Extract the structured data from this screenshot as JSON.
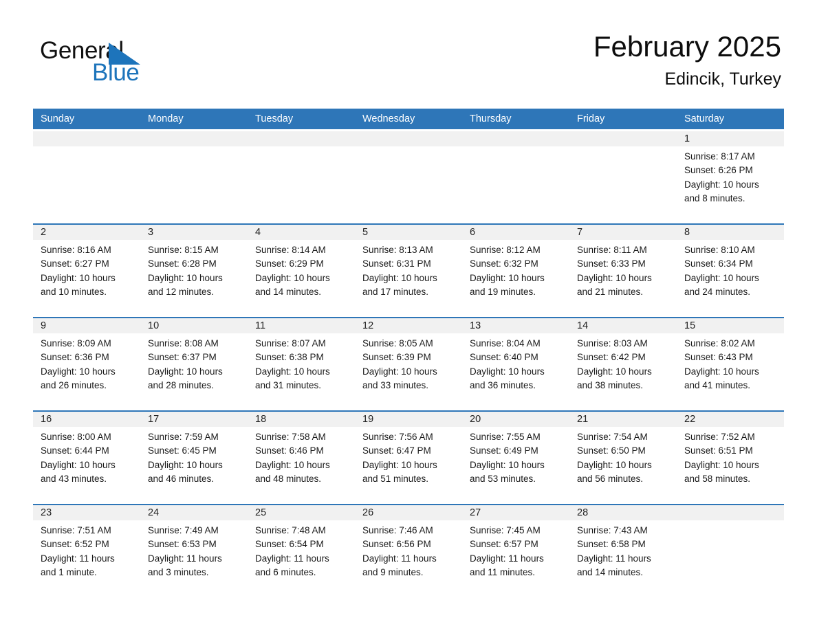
{
  "brand": {
    "name_part1": "General",
    "name_part2": "Blue",
    "accent_color": "#1d74bb",
    "triangle_icon": "triangle-icon"
  },
  "header": {
    "title": "February 2025",
    "location": "Edincik, Turkey"
  },
  "calendar": {
    "header_bg": "#2e76b8",
    "date_band_bg": "#f1f1f1",
    "weekdays": [
      "Sunday",
      "Monday",
      "Tuesday",
      "Wednesday",
      "Thursday",
      "Friday",
      "Saturday"
    ],
    "weeks": [
      [
        {
          "day": "",
          "sunrise": "",
          "sunset": "",
          "daylight1": "",
          "daylight2": "",
          "empty": true
        },
        {
          "day": "",
          "sunrise": "",
          "sunset": "",
          "daylight1": "",
          "daylight2": "",
          "empty": true
        },
        {
          "day": "",
          "sunrise": "",
          "sunset": "",
          "daylight1": "",
          "daylight2": "",
          "empty": true
        },
        {
          "day": "",
          "sunrise": "",
          "sunset": "",
          "daylight1": "",
          "daylight2": "",
          "empty": true
        },
        {
          "day": "",
          "sunrise": "",
          "sunset": "",
          "daylight1": "",
          "daylight2": "",
          "empty": true
        },
        {
          "day": "",
          "sunrise": "",
          "sunset": "",
          "daylight1": "",
          "daylight2": "",
          "empty": true
        },
        {
          "day": "1",
          "sunrise": "Sunrise: 8:17 AM",
          "sunset": "Sunset: 6:26 PM",
          "daylight1": "Daylight: 10 hours",
          "daylight2": "and 8 minutes.",
          "empty": false
        }
      ],
      [
        {
          "day": "2",
          "sunrise": "Sunrise: 8:16 AM",
          "sunset": "Sunset: 6:27 PM",
          "daylight1": "Daylight: 10 hours",
          "daylight2": "and 10 minutes.",
          "empty": false
        },
        {
          "day": "3",
          "sunrise": "Sunrise: 8:15 AM",
          "sunset": "Sunset: 6:28 PM",
          "daylight1": "Daylight: 10 hours",
          "daylight2": "and 12 minutes.",
          "empty": false
        },
        {
          "day": "4",
          "sunrise": "Sunrise: 8:14 AM",
          "sunset": "Sunset: 6:29 PM",
          "daylight1": "Daylight: 10 hours",
          "daylight2": "and 14 minutes.",
          "empty": false
        },
        {
          "day": "5",
          "sunrise": "Sunrise: 8:13 AM",
          "sunset": "Sunset: 6:31 PM",
          "daylight1": "Daylight: 10 hours",
          "daylight2": "and 17 minutes.",
          "empty": false
        },
        {
          "day": "6",
          "sunrise": "Sunrise: 8:12 AM",
          "sunset": "Sunset: 6:32 PM",
          "daylight1": "Daylight: 10 hours",
          "daylight2": "and 19 minutes.",
          "empty": false
        },
        {
          "day": "7",
          "sunrise": "Sunrise: 8:11 AM",
          "sunset": "Sunset: 6:33 PM",
          "daylight1": "Daylight: 10 hours",
          "daylight2": "and 21 minutes.",
          "empty": false
        },
        {
          "day": "8",
          "sunrise": "Sunrise: 8:10 AM",
          "sunset": "Sunset: 6:34 PM",
          "daylight1": "Daylight: 10 hours",
          "daylight2": "and 24 minutes.",
          "empty": false
        }
      ],
      [
        {
          "day": "9",
          "sunrise": "Sunrise: 8:09 AM",
          "sunset": "Sunset: 6:36 PM",
          "daylight1": "Daylight: 10 hours",
          "daylight2": "and 26 minutes.",
          "empty": false
        },
        {
          "day": "10",
          "sunrise": "Sunrise: 8:08 AM",
          "sunset": "Sunset: 6:37 PM",
          "daylight1": "Daylight: 10 hours",
          "daylight2": "and 28 minutes.",
          "empty": false
        },
        {
          "day": "11",
          "sunrise": "Sunrise: 8:07 AM",
          "sunset": "Sunset: 6:38 PM",
          "daylight1": "Daylight: 10 hours",
          "daylight2": "and 31 minutes.",
          "empty": false
        },
        {
          "day": "12",
          "sunrise": "Sunrise: 8:05 AM",
          "sunset": "Sunset: 6:39 PM",
          "daylight1": "Daylight: 10 hours",
          "daylight2": "and 33 minutes.",
          "empty": false
        },
        {
          "day": "13",
          "sunrise": "Sunrise: 8:04 AM",
          "sunset": "Sunset: 6:40 PM",
          "daylight1": "Daylight: 10 hours",
          "daylight2": "and 36 minutes.",
          "empty": false
        },
        {
          "day": "14",
          "sunrise": "Sunrise: 8:03 AM",
          "sunset": "Sunset: 6:42 PM",
          "daylight1": "Daylight: 10 hours",
          "daylight2": "and 38 minutes.",
          "empty": false
        },
        {
          "day": "15",
          "sunrise": "Sunrise: 8:02 AM",
          "sunset": "Sunset: 6:43 PM",
          "daylight1": "Daylight: 10 hours",
          "daylight2": "and 41 minutes.",
          "empty": false
        }
      ],
      [
        {
          "day": "16",
          "sunrise": "Sunrise: 8:00 AM",
          "sunset": "Sunset: 6:44 PM",
          "daylight1": "Daylight: 10 hours",
          "daylight2": "and 43 minutes.",
          "empty": false
        },
        {
          "day": "17",
          "sunrise": "Sunrise: 7:59 AM",
          "sunset": "Sunset: 6:45 PM",
          "daylight1": "Daylight: 10 hours",
          "daylight2": "and 46 minutes.",
          "empty": false
        },
        {
          "day": "18",
          "sunrise": "Sunrise: 7:58 AM",
          "sunset": "Sunset: 6:46 PM",
          "daylight1": "Daylight: 10 hours",
          "daylight2": "and 48 minutes.",
          "empty": false
        },
        {
          "day": "19",
          "sunrise": "Sunrise: 7:56 AM",
          "sunset": "Sunset: 6:47 PM",
          "daylight1": "Daylight: 10 hours",
          "daylight2": "and 51 minutes.",
          "empty": false
        },
        {
          "day": "20",
          "sunrise": "Sunrise: 7:55 AM",
          "sunset": "Sunset: 6:49 PM",
          "daylight1": "Daylight: 10 hours",
          "daylight2": "and 53 minutes.",
          "empty": false
        },
        {
          "day": "21",
          "sunrise": "Sunrise: 7:54 AM",
          "sunset": "Sunset: 6:50 PM",
          "daylight1": "Daylight: 10 hours",
          "daylight2": "and 56 minutes.",
          "empty": false
        },
        {
          "day": "22",
          "sunrise": "Sunrise: 7:52 AM",
          "sunset": "Sunset: 6:51 PM",
          "daylight1": "Daylight: 10 hours",
          "daylight2": "and 58 minutes.",
          "empty": false
        }
      ],
      [
        {
          "day": "23",
          "sunrise": "Sunrise: 7:51 AM",
          "sunset": "Sunset: 6:52 PM",
          "daylight1": "Daylight: 11 hours",
          "daylight2": "and 1 minute.",
          "empty": false
        },
        {
          "day": "24",
          "sunrise": "Sunrise: 7:49 AM",
          "sunset": "Sunset: 6:53 PM",
          "daylight1": "Daylight: 11 hours",
          "daylight2": "and 3 minutes.",
          "empty": false
        },
        {
          "day": "25",
          "sunrise": "Sunrise: 7:48 AM",
          "sunset": "Sunset: 6:54 PM",
          "daylight1": "Daylight: 11 hours",
          "daylight2": "and 6 minutes.",
          "empty": false
        },
        {
          "day": "26",
          "sunrise": "Sunrise: 7:46 AM",
          "sunset": "Sunset: 6:56 PM",
          "daylight1": "Daylight: 11 hours",
          "daylight2": "and 9 minutes.",
          "empty": false
        },
        {
          "day": "27",
          "sunrise": "Sunrise: 7:45 AM",
          "sunset": "Sunset: 6:57 PM",
          "daylight1": "Daylight: 11 hours",
          "daylight2": "and 11 minutes.",
          "empty": false
        },
        {
          "day": "28",
          "sunrise": "Sunrise: 7:43 AM",
          "sunset": "Sunset: 6:58 PM",
          "daylight1": "Daylight: 11 hours",
          "daylight2": "and 14 minutes.",
          "empty": false
        },
        {
          "day": "",
          "sunrise": "",
          "sunset": "",
          "daylight1": "",
          "daylight2": "",
          "empty": true
        }
      ]
    ]
  }
}
